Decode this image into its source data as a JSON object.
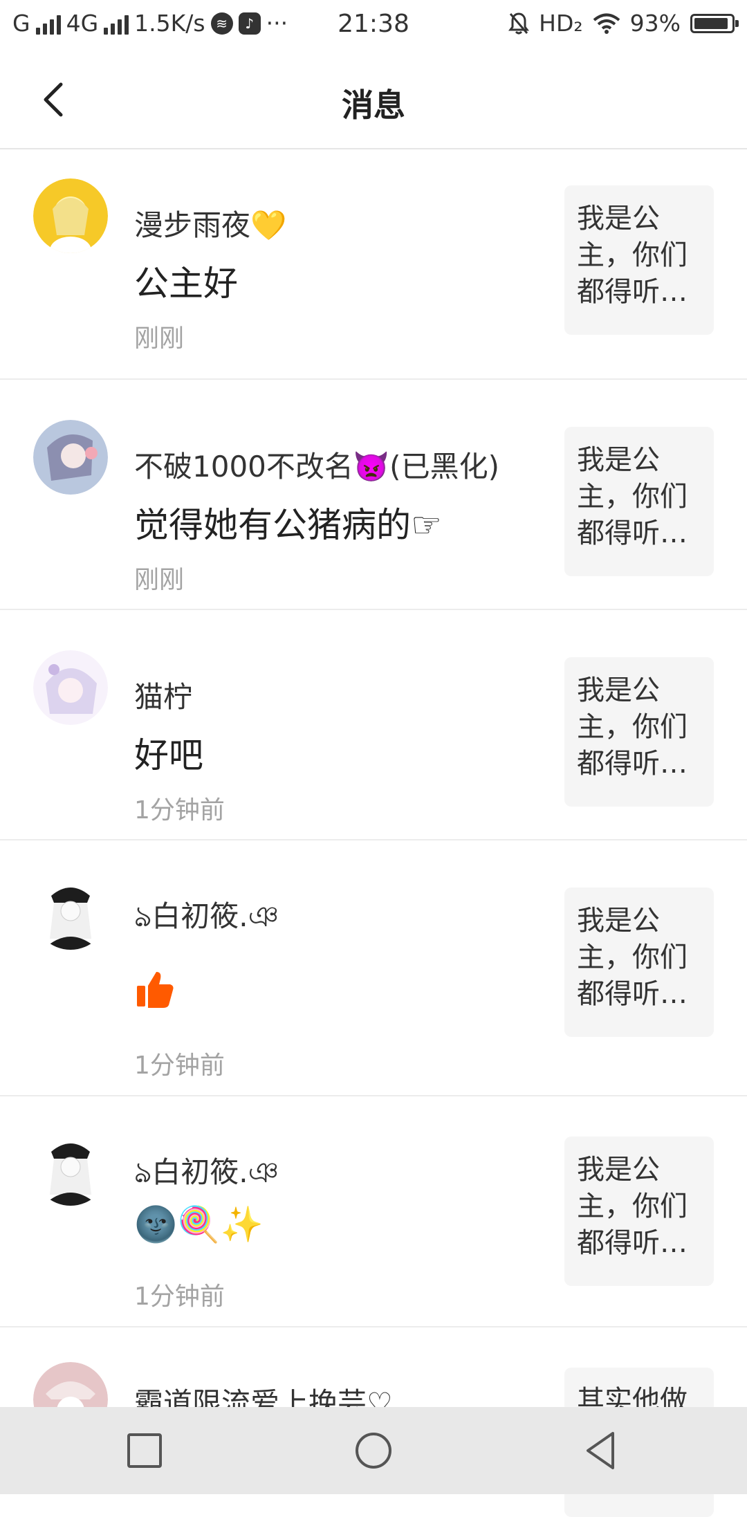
{
  "status_bar": {
    "signal1": "G",
    "signal2": "4G",
    "net_speed": "1.5K/s",
    "more": "···",
    "time": "21:38",
    "hd": "HD₂",
    "battery": "93%",
    "battery_level": 0.93
  },
  "header": {
    "title": "消息"
  },
  "messages": [
    {
      "name": "漫步雨夜💛",
      "text": "公主好",
      "time": "刚刚",
      "quote_lines": [
        "我是公",
        "主，你们",
        "都得听…"
      ],
      "avatar_color": "#f6c928",
      "avatar_accent": "#fff3b0"
    },
    {
      "name": "不破1000不改名👿(已黑化)",
      "text": "觉得她有公猪病的☞",
      "time": "刚刚",
      "quote_lines": [
        "我是公",
        "主，你们",
        "都得听…"
      ],
      "avatar_color": "#b9c7de",
      "avatar_accent": "#f2a8b5"
    },
    {
      "name": "猫柠",
      "text": "好吧",
      "time": "1分钟前",
      "quote_lines": [
        "我是公",
        "主，你们",
        "都得听…"
      ],
      "avatar_color": "#dcd3ee",
      "avatar_accent": "#f7f2fb"
    },
    {
      "name": "ঌ白初筱.ঞ",
      "text": "👍",
      "time": "1分钟前",
      "quote_lines": [
        "我是公",
        "主，你们",
        "都得听…"
      ],
      "avatar_color": "#1d1d1d",
      "avatar_accent": "#f0f0f0"
    },
    {
      "name": "ঌ白初筱.ঞ",
      "text": "🌚🍭✨",
      "time": "1分钟前",
      "quote_lines": [
        "我是公",
        "主，你们",
        "都得听…"
      ],
      "avatar_color": "#1d1d1d",
      "avatar_accent": "#f0f0f0"
    },
    {
      "name": "霸道限流爱上挽芸♡",
      "text": "",
      "time": "",
      "quote_lines": [
        "其实他做"
      ],
      "avatar_color": "#e6c6c8",
      "avatar_accent": "#ffffff"
    }
  ],
  "nav": {
    "square_icon": "recent-apps-icon",
    "circle_icon": "home-icon",
    "triangle_icon": "back-nav-icon"
  }
}
